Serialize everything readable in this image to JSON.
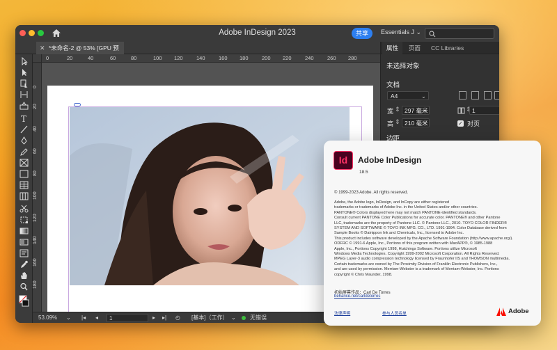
{
  "window": {
    "title": "Adobe InDesign 2023",
    "share_label": "共享",
    "workspace": "Essentials J ⌄",
    "document_tab": "*未命名-2 @ 53% [GPU 预览]"
  },
  "ruler": {
    "h_ticks": [
      "0",
      "20",
      "40",
      "60",
      "80",
      "100",
      "120",
      "140",
      "160",
      "180",
      "200",
      "220",
      "240",
      "260",
      "280"
    ],
    "v_ticks": [
      "0",
      "2",
      "4",
      "6",
      "8",
      "1",
      "1",
      "1",
      "1",
      "1"
    ]
  },
  "status": {
    "zoom": "53.09%",
    "page": "1",
    "style": "[基本]（工作）",
    "preflight": "无错误"
  },
  "properties": {
    "tabs": [
      "属性",
      "页面",
      "CC Libraries"
    ],
    "no_selection": "未选择对象",
    "document_label": "文档",
    "page_size": "A4",
    "width_label": "宽",
    "width_value": "297 毫米",
    "height_label": "高",
    "height_value": "210 毫米",
    "pages_value": "1",
    "facing_pages": "对页",
    "margins_label": "边距"
  },
  "about": {
    "product": "Adobe InDesign",
    "logo_text": "Id",
    "version": "18.5",
    "copyright": "© 1999-2023 Adobe. All rights reserved.",
    "legal_lines": [
      "Adobe, the Adobe logo, InDesign, and InCopy are either registered",
      "trademarks or trademarks of Adobe Inc. in the United States and/or other countries.",
      "PANTONE® Colors displayed here may not match PANTONE-identified standards.",
      "Consult current PANTONE Color Publications for accurate color. PANTONE® and other Pantone",
      "LLC, trademarks are the property of Pantone LLC. © Pantone LLC., 2010. TOYO COLOR FINDER®",
      "SYSTEM AND SOFTWARE © TOYO INK MFG. CO., LTD. 1991-1994. Color Database derived from",
      "Sample Books © Dainippon Ink and Chemicals, Inc., licensed to Adobe Inc.",
      "This product includes software developed by the Apache Software Foundation (http://www.apache.org/).",
      "ODFRC © 1991-6 Apple, Inc., Portions of this program written with MacAPP®, © 1985-1988",
      "Apple, Inc., Portions Copyright 1998, Hutchings Software. Portions utilize Microsoft",
      "Windows Media Technologies. Copyright 1999-2002 Microsoft Corporation. All Rights Reserved.",
      "MPEG Layer-3 audio compression technology licensed by Fraunhofer IIS and THOMSON multimedia.",
      "Certain trademarks are owned by The Proximity Division of Franklin Electronic Publishers, Inc.,",
      "and are used by permission. Merriam-Webster is a trademark of Merriam-Webster, Inc. Portions",
      "copyright © Chris Maunder, 1998."
    ],
    "credit_label": "初始屏幕作品：Carl De Torres",
    "credit_link": "behance.net/carldetorres",
    "legal_link": "法律声明",
    "credits_link": "参与人员名单",
    "brand_word": "Adobe"
  },
  "colors": {
    "accent_blue": "#2d7ff0",
    "indesign_pink": "#ff3366",
    "indesign_bg": "#49021f",
    "adobe_red": "#fa0f00"
  }
}
